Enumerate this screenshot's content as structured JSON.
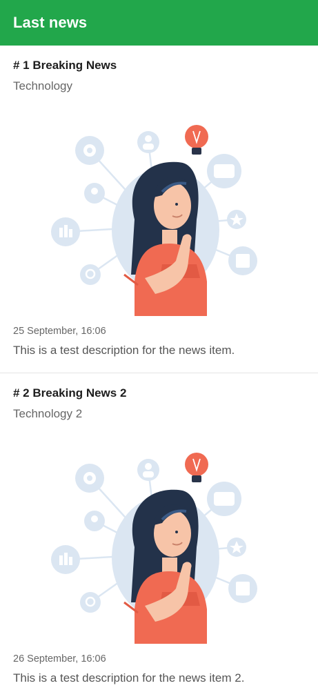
{
  "appbar": {
    "title": "Last news"
  },
  "colors": {
    "appbar": "#22a74b",
    "divider": "#e4e4e4",
    "illustration_accent": "#f06a52"
  },
  "news": [
    {
      "title": "# 1 Breaking News",
      "category": "Technology",
      "date": "25 September, 16:06",
      "description": "This is a test description for the news item.",
      "image_icon": "thinking-woman-illustration"
    },
    {
      "title": "# 2 Breaking News 2",
      "category": "Technology 2",
      "date": "26 September, 16:06",
      "description": "This is a test description for the news item 2.",
      "image_icon": "thinking-woman-illustration"
    }
  ]
}
